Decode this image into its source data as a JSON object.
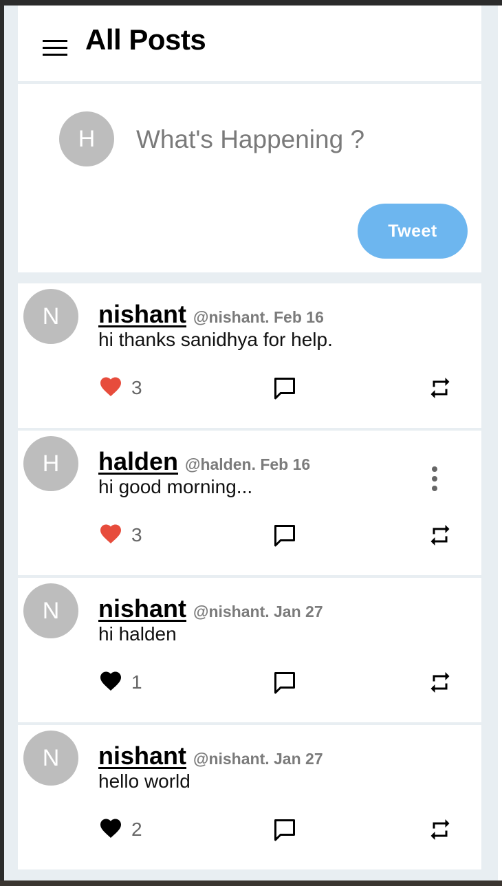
{
  "header": {
    "title": "All Posts",
    "menu_icon": "menu-icon"
  },
  "composer": {
    "avatar_initial": "H",
    "placeholder": "What's Happening ?",
    "tweet_label": "Tweet"
  },
  "colors": {
    "accent": "#6db6ef",
    "liked": "#e74c3c",
    "unliked": "#000000",
    "avatar": "#bdbdbd"
  },
  "posts": [
    {
      "initial": "N",
      "name": "nishant",
      "handle": "@nishant. Feb 16",
      "text": "hi thanks sanidhya for help.",
      "likes": "3",
      "liked": true,
      "has_more_menu": false
    },
    {
      "initial": "H",
      "name": "halden",
      "handle": "@halden. Feb 16",
      "text": "hi good morning...",
      "likes": "3",
      "liked": true,
      "has_more_menu": true
    },
    {
      "initial": "N",
      "name": "nishant",
      "handle": "@nishant. Jan 27",
      "text": "hi halden",
      "likes": "1",
      "liked": false,
      "has_more_menu": false
    },
    {
      "initial": "N",
      "name": "nishant",
      "handle": "@nishant. Jan 27",
      "text": "hello world",
      "likes": "2",
      "liked": false,
      "has_more_menu": false
    }
  ]
}
